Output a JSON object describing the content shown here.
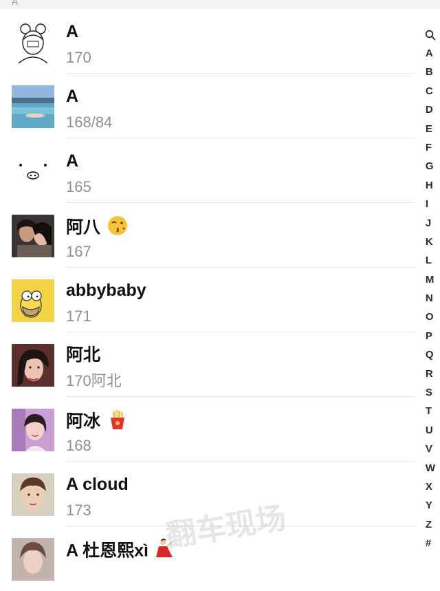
{
  "section_header": "A",
  "contacts": [
    {
      "name": "A",
      "sub": "170",
      "avatar": "sketch-girl-avatar"
    },
    {
      "name": "A",
      "sub": "168/84",
      "avatar": "beach-photo-avatar"
    },
    {
      "name": "A",
      "sub": "165",
      "avatar": "pig-face-avatar"
    },
    {
      "name": "阿八",
      "sub": "167",
      "avatar": "couple-photo-avatar",
      "emoji": "kissing-face-emoji"
    },
    {
      "name": "abbybaby",
      "sub": "171",
      "avatar": "cartoon-yellow-avatar"
    },
    {
      "name": "阿北",
      "sub": "170阿北",
      "avatar": "girl-photo-avatar"
    },
    {
      "name": "阿冰",
      "sub": "168",
      "avatar": "woman-photo-avatar",
      "emoji": "french-fries-emoji"
    },
    {
      "name": "A cloud",
      "sub": "173",
      "avatar": "child-photo-avatar"
    },
    {
      "name": "A 杜恩熙xì",
      "sub": "",
      "avatar": "portrait-photo-avatar",
      "emoji": "dancer-emoji"
    }
  ],
  "index": [
    "A",
    "B",
    "C",
    "D",
    "E",
    "F",
    "G",
    "H",
    "I",
    "J",
    "K",
    "L",
    "M",
    "N",
    "O",
    "P",
    "Q",
    "R",
    "S",
    "T",
    "U",
    "V",
    "W",
    "X",
    "Y",
    "Z",
    "#"
  ],
  "watermark": "翻车现场"
}
